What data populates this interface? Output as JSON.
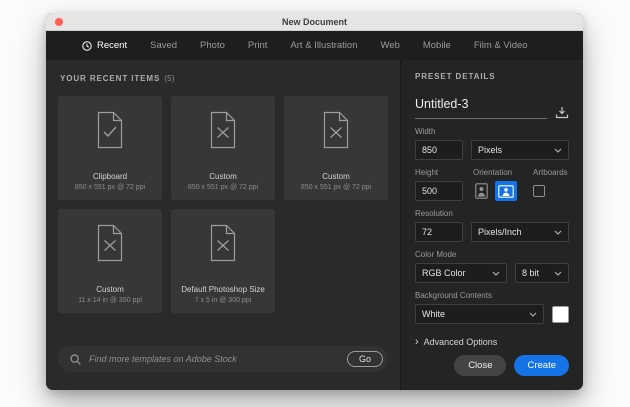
{
  "window": {
    "title": "New Document"
  },
  "tabs": [
    {
      "label": "Recent"
    },
    {
      "label": "Saved"
    },
    {
      "label": "Photo"
    },
    {
      "label": "Print"
    },
    {
      "label": "Art & Illustration"
    },
    {
      "label": "Web"
    },
    {
      "label": "Mobile"
    },
    {
      "label": "Film & Video"
    }
  ],
  "recent": {
    "heading": "YOUR RECENT ITEMS",
    "count": "(5)",
    "items": [
      {
        "name": "Clipboard",
        "detail": "850 x 551 px @ 72 ppi",
        "icon": "clipboard-check-document-icon"
      },
      {
        "name": "Custom",
        "detail": "850 x 551 px @ 72 ppi",
        "icon": "custom-document-icon"
      },
      {
        "name": "Custom",
        "detail": "850 x 551 px @ 72 ppi",
        "icon": "custom-document-icon"
      },
      {
        "name": "Custom",
        "detail": "11 x 14 in @ 350 ppi",
        "icon": "custom-document-icon"
      },
      {
        "name": "Default Photoshop Size",
        "detail": "7 x 5 in @ 300 ppi",
        "icon": "custom-document-icon"
      }
    ],
    "search": {
      "placeholder": "Find more templates on Adobe Stock",
      "go_label": "Go"
    }
  },
  "preset": {
    "heading": "PRESET DETAILS",
    "name_value": "Untitled-3",
    "width": {
      "label": "Width",
      "value": "850",
      "unit": "Pixels"
    },
    "height": {
      "label": "Height",
      "value": "500"
    },
    "orientation_label": "Orientation",
    "artboards_label": "Artboards",
    "resolution": {
      "label": "Resolution",
      "value": "72",
      "unit": "Pixels/Inch"
    },
    "color_mode": {
      "label": "Color Mode",
      "value": "RGB Color",
      "bit_depth": "8 bit"
    },
    "background": {
      "label": "Background Contents",
      "value": "White"
    },
    "advanced_label": "Advanced Options",
    "buttons": {
      "close": "Close",
      "create": "Create"
    }
  },
  "colors": {
    "accent": "#1473e6",
    "background_swatch": "#ffffff"
  }
}
